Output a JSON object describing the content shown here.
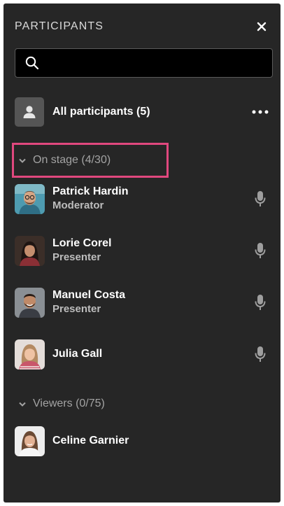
{
  "panel": {
    "title": "PARTICIPANTS",
    "close_icon": "close-icon"
  },
  "search": {
    "icon": "search-icon",
    "placeholder": "",
    "value": ""
  },
  "all_participants": {
    "icon": "user-icon",
    "label": "All participants (5)",
    "more_icon": "more-horizontal-icon"
  },
  "on_stage": {
    "label": "On stage (4/30)",
    "highlight_color": "#e0487e",
    "participants": [
      {
        "name": "Patrick Hardin",
        "role": "Moderator",
        "mic_icon": "microphone-icon"
      },
      {
        "name": "Lorie Corel",
        "role": "Presenter",
        "mic_icon": "microphone-icon"
      },
      {
        "name": "Manuel Costa",
        "role": "Presenter",
        "mic_icon": "microphone-icon"
      },
      {
        "name": "Julia Gall",
        "role": "",
        "mic_icon": "microphone-icon"
      }
    ]
  },
  "viewers": {
    "label": "Viewers (0/75)",
    "participants": [
      {
        "name": "Celine Garnier"
      }
    ]
  },
  "colors": {
    "panel_bg": "#262626",
    "text_primary": "#ffffff",
    "text_secondary": "#bdbdbd",
    "section_text": "#a3a3a3",
    "icon_gray": "#9e9e9e"
  }
}
